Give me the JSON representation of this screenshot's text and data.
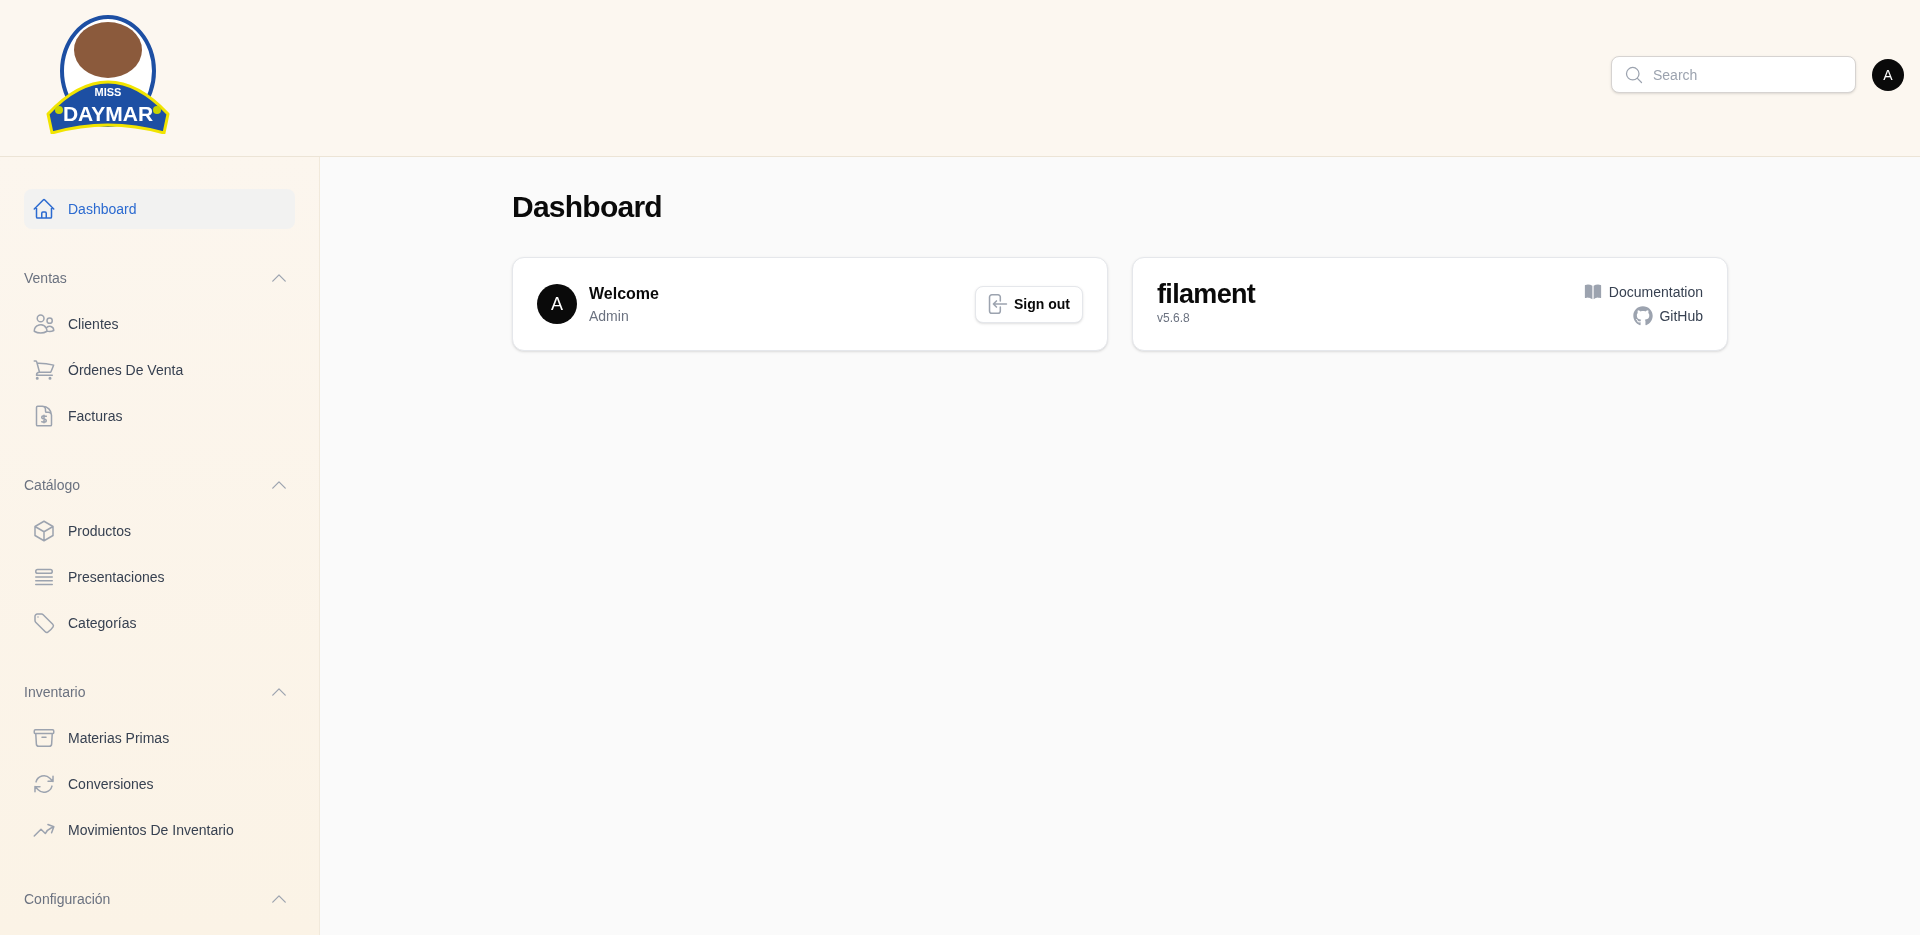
{
  "header": {
    "logo": {
      "line_1": "MISS",
      "line_2": "DAYMAR"
    },
    "search": {
      "placeholder": "Search"
    },
    "user_avatar": "A"
  },
  "sidebar": {
    "items": [
      {
        "label": "Dashboard",
        "selected": true
      }
    ],
    "groups": [
      {
        "label": "Ventas",
        "expanded": true,
        "items": [
          {
            "label": "Clientes",
            "selected": false
          },
          {
            "label": "Órdenes De Venta",
            "selected": false
          },
          {
            "label": "Facturas",
            "selected": false
          }
        ]
      },
      {
        "label": "Catálogo",
        "expanded": true,
        "items": [
          {
            "label": "Productos",
            "selected": false
          },
          {
            "label": "Presentaciones",
            "selected": false
          },
          {
            "label": "Categorías",
            "selected": false
          }
        ]
      },
      {
        "label": "Inventario",
        "expanded": true,
        "items": [
          {
            "label": "Materias Primas",
            "selected": false
          },
          {
            "label": "Conversiones",
            "selected": false
          },
          {
            "label": "Movimientos De Inventario",
            "selected": false
          }
        ]
      },
      {
        "label": "Configuración",
        "expanded": true
      }
    ]
  },
  "page": {
    "title": "Dashboard",
    "account_widget": {
      "avatar": "A",
      "greeting": "Welcome",
      "user_name": "Admin",
      "sign_out_button": "Sign out"
    },
    "info_widget": {
      "brand": "filament",
      "version": "v5.6.8",
      "links": [
        "Documentation",
        "GitHub"
      ]
    }
  }
}
